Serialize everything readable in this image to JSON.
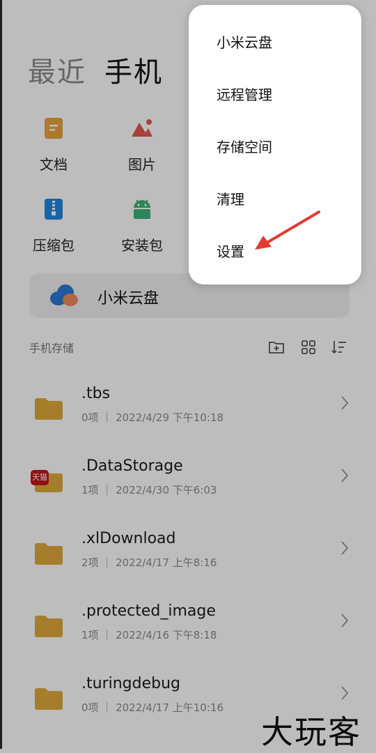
{
  "tabs": {
    "recent": "最近",
    "phone": "手机"
  },
  "categories": {
    "docs": "文档",
    "images": "图片",
    "archives": "压缩包",
    "apks": "安装包"
  },
  "cloud": {
    "label": "小米云盘"
  },
  "storage": {
    "section_title": "手机存储"
  },
  "files": [
    {
      "name": ".tbs",
      "meta": "0项 ｜ 2022/4/29 下午10:18"
    },
    {
      "name": ".DataStorage",
      "meta": "1项 ｜ 2022/4/30 下午6:03",
      "badge": "天猫"
    },
    {
      "name": ".xlDownload",
      "meta": "2项 ｜ 2022/4/17 上午8:16"
    },
    {
      "name": ".protected_image",
      "meta": "1项 ｜ 2022/4/16 下午8:18"
    },
    {
      "name": ".turingdebug",
      "meta": "0项 ｜ 2022/4/17 上午10:16"
    }
  ],
  "menu": {
    "items": [
      "小米云盘",
      "远程管理",
      "存储空间",
      "清理",
      "设置"
    ]
  },
  "watermark": "大玩客",
  "colors": {
    "folder": "#e0a93a",
    "accent_red": "#e53a2e",
    "apk_green": "#3fb37a",
    "archive_blue": "#1e88e5"
  }
}
